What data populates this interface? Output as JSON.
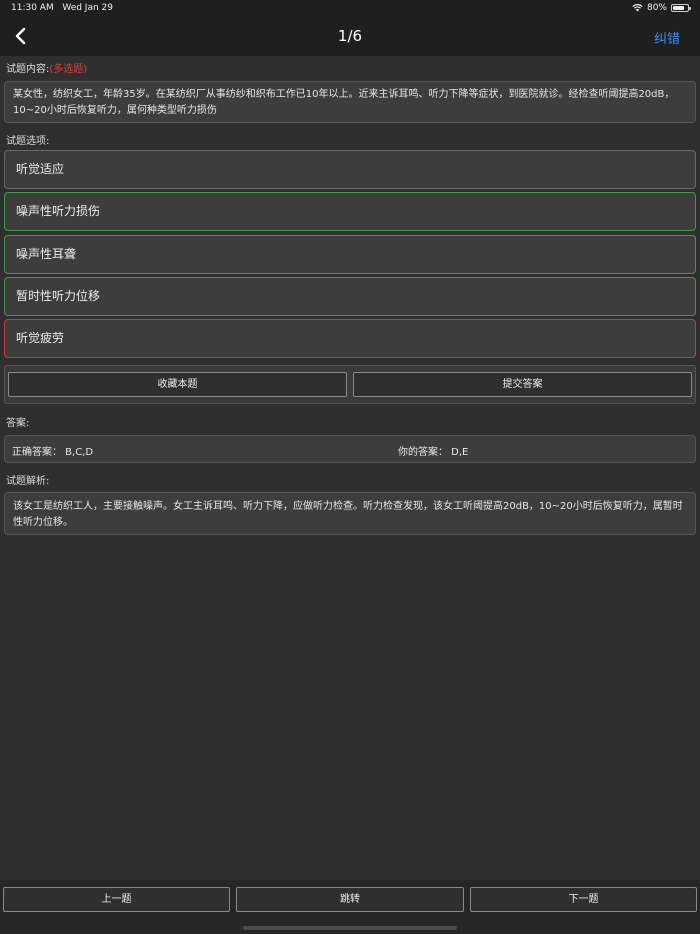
{
  "status": {
    "time": "11:30 AM",
    "date": "Wed Jan 29",
    "battery": "80%",
    "battery_level": 0.8
  },
  "nav": {
    "title": "1/6",
    "action": "纠错"
  },
  "question": {
    "label": "试题内容:",
    "type_tag": "(多选题)",
    "text": "某女性，纺织女工，年龄35岁。在某纺织厂从事纺纱和织布工作已10年以上。近来主诉耳鸣、听力下降等症状，到医院就诊。经检查听阈提高20dB，10~20小时后恢复听力，属何种类型听力损伤"
  },
  "options_label": "试题选项:",
  "options": [
    {
      "label": "听觉适应",
      "state": "neutral"
    },
    {
      "label": "噪声性听力损伤",
      "state": "correct"
    },
    {
      "label": "噪声性耳聋",
      "state": "correct"
    },
    {
      "label": "暂时性听力位移",
      "state": "correct"
    },
    {
      "label": "听觉疲劳",
      "state": "wrong"
    }
  ],
  "actions": {
    "favorite": "收藏本题",
    "submit": "提交答案"
  },
  "answer": {
    "label": "答案:",
    "correct": "正确答案： B,C,D",
    "yours": "你的答案： D,E"
  },
  "analysis": {
    "label": "试题解析:",
    "text": "该女工是纺织工人，主要接触噪声。女工主诉耳鸣、听力下降，应做听力检查。听力检查发现，该女工听阈提高20dB，10~20小时后恢复听力，属暂时性听力位移。"
  },
  "footer": {
    "prev": "上一题",
    "jump": "跳转",
    "next": "下一题"
  },
  "colors": {
    "accent": "#3f8ef0",
    "correct": "#3e9b4a",
    "wrong": "#c73a3a",
    "tag": "#e23a3a"
  }
}
